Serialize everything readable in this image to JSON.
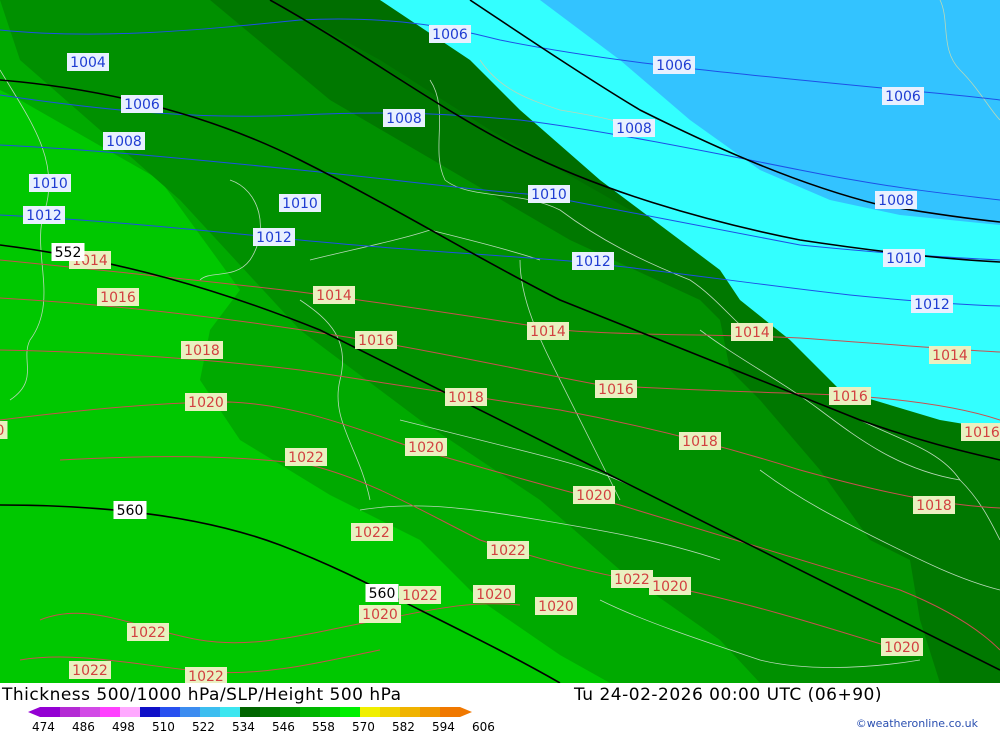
{
  "title": {
    "left": "Thickness 500/1000 hPa/SLP/Height 500 hPa",
    "right": "Tu 24-02-2026 00:00 UTC (06+90)"
  },
  "credit": "©weatheronline.co.uk",
  "legend": {
    "colors": [
      "#9400d3",
      "#b42ad4",
      "#d24ae6",
      "#ff40ff",
      "#ffa8ff",
      "#1010c8",
      "#2850f0",
      "#3c8cf0",
      "#3cbef0",
      "#3ce6f0",
      "#006400",
      "#007d00",
      "#009600",
      "#00b400",
      "#00d200",
      "#00f000",
      "#f0f000",
      "#f0d200",
      "#f0b400",
      "#f09600",
      "#f07800"
    ],
    "labels": [
      "474",
      "486",
      "498",
      "510",
      "522",
      "534",
      "546",
      "558",
      "570",
      "582",
      "594",
      "606"
    ]
  },
  "map": {
    "band_colors": {
      "546": "#00c800",
      "552": "#00aa00",
      "558": "#009000",
      "564": "#007800",
      "570": "#006e00",
      "sea_cyan": "#33ffff",
      "sea_blue": "#33c3ff"
    },
    "slp_labels": [
      {
        "text": "1004",
        "color": "blue"
      },
      {
        "text": "1006",
        "color": "blue"
      },
      {
        "text": "1006",
        "color": "blue"
      },
      {
        "text": "1006",
        "color": "blue"
      },
      {
        "text": "1006",
        "color": "blue"
      },
      {
        "text": "1008",
        "color": "blue"
      },
      {
        "text": "1008",
        "color": "blue"
      },
      {
        "text": "1008",
        "color": "blue"
      },
      {
        "text": "1008",
        "color": "blue"
      },
      {
        "text": "1010",
        "color": "blue"
      },
      {
        "text": "1010",
        "color": "blue"
      },
      {
        "text": "1010",
        "color": "blue"
      },
      {
        "text": "1010",
        "color": "blue"
      },
      {
        "text": "1012",
        "color": "blue"
      },
      {
        "text": "1012",
        "color": "blue"
      },
      {
        "text": "1012",
        "color": "blue"
      },
      {
        "text": "1012",
        "color": "blue"
      },
      {
        "text": "1014",
        "color": "red"
      },
      {
        "text": "1014",
        "color": "red"
      },
      {
        "text": "1014",
        "color": "red"
      },
      {
        "text": "1014",
        "color": "red"
      },
      {
        "text": "1014",
        "color": "red"
      },
      {
        "text": "1016",
        "color": "red"
      },
      {
        "text": "1016",
        "color": "red"
      },
      {
        "text": "1016",
        "color": "red"
      },
      {
        "text": "1016",
        "color": "red"
      },
      {
        "text": "1016",
        "color": "red"
      },
      {
        "text": "1018",
        "color": "red"
      },
      {
        "text": "1018",
        "color": "red"
      },
      {
        "text": "1018",
        "color": "red"
      },
      {
        "text": "1018",
        "color": "red"
      },
      {
        "text": "1020",
        "color": "red"
      },
      {
        "text": "1020",
        "color": "red"
      },
      {
        "text": "1020",
        "color": "red"
      },
      {
        "text": "1020",
        "color": "red"
      },
      {
        "text": "1020",
        "color": "red"
      },
      {
        "text": "1020",
        "color": "red"
      },
      {
        "text": "1020",
        "color": "red"
      },
      {
        "text": "1020",
        "color": "red"
      },
      {
        "text": "1022",
        "color": "red"
      },
      {
        "text": "1022",
        "color": "red"
      },
      {
        "text": "1022",
        "color": "red"
      },
      {
        "text": "1022",
        "color": "red"
      },
      {
        "text": "1022",
        "color": "red"
      },
      {
        "text": "1022",
        "color": "red"
      },
      {
        "text": "1022",
        "color": "red"
      },
      {
        "text": "1022",
        "color": "red"
      },
      {
        "text": "0",
        "color": "red"
      }
    ],
    "height_labels": [
      {
        "text": "552"
      },
      {
        "text": "560"
      },
      {
        "text": "560"
      }
    ]
  }
}
